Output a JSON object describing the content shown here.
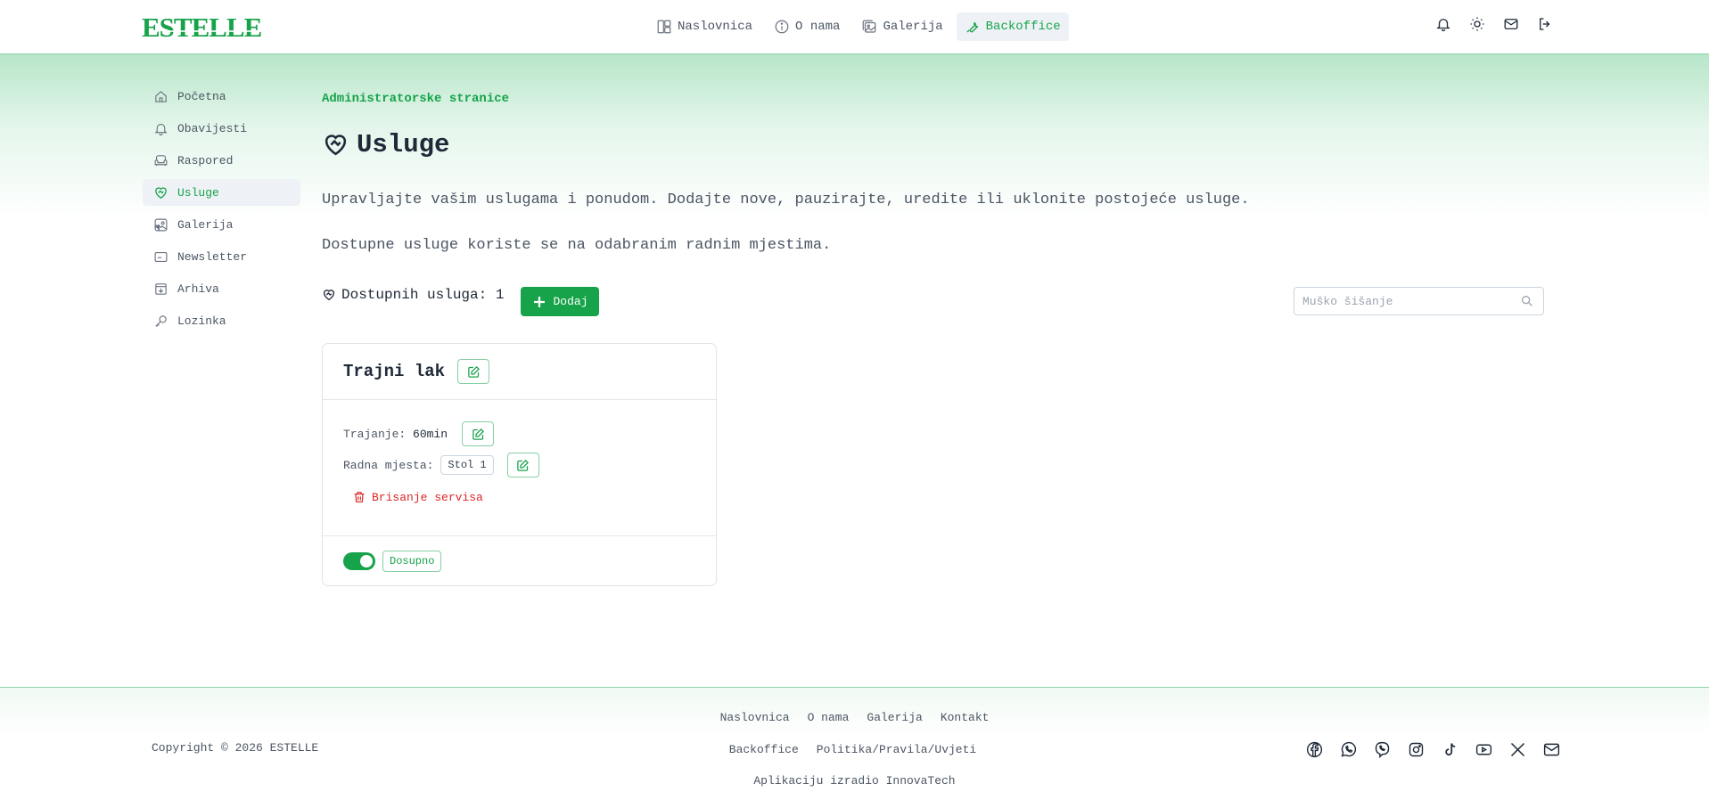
{
  "brand": {
    "logo_text": "ESTELLE",
    "accent": "#16a34a"
  },
  "topnav": [
    {
      "label": "Naslovnica",
      "icon": "layout-icon"
    },
    {
      "label": "O nama",
      "icon": "info-icon"
    },
    {
      "label": "Galerija",
      "icon": "gallery-icon"
    },
    {
      "label": "Backoffice",
      "icon": "wrench-icon",
      "active": true
    }
  ],
  "top_actions": [
    "bell-icon",
    "sun-icon",
    "mail-icon",
    "logout-icon"
  ],
  "sidebar": {
    "items": [
      {
        "label": "Početna",
        "icon": "home-icon"
      },
      {
        "label": "Obavijesti",
        "icon": "bell-icon"
      },
      {
        "label": "Raspored",
        "icon": "armchair-icon"
      },
      {
        "label": "Usluge",
        "icon": "heart-handshake-icon",
        "active": true
      },
      {
        "label": "Galerija",
        "icon": "gallery-icon"
      },
      {
        "label": "Newsletter",
        "icon": "newsletter-icon"
      },
      {
        "label": "Arhiva",
        "icon": "archive-icon"
      },
      {
        "label": "Lozinka",
        "icon": "key-icon"
      }
    ]
  },
  "main": {
    "breadcrumb": "Administratorske stranice",
    "title": "Usluge",
    "description": "Upravljajte vašim uslugama i ponudom. Dodajte nove, pauzirajte, uredite ili uklonite postojeće usluge.",
    "description2": "Dostupne usluge koriste se na odabranim radnim mjestima.",
    "count_label": "Dostupnih usluga: 1",
    "add_label": "Dodaj",
    "search_placeholder": "Muško šišanje"
  },
  "service_card": {
    "name": "Trajni lak",
    "duration_label": "Trajanje:",
    "duration_value": "60min",
    "workplaces_label": "Radna mjesta:",
    "workplaces": [
      "Stol 1"
    ],
    "delete_label": "Brisanje servisa",
    "status_label": "Dosupno",
    "enabled": true
  },
  "footer": {
    "copyright": "Copyright © 2026 ESTELLE",
    "links_row1": [
      "Naslovnica",
      "O nama",
      "Galerija",
      "Kontakt"
    ],
    "links_row2": [
      "Backoffice",
      "Politika/Pravila/Uvjeti"
    ],
    "credit": "Aplikaciju izradio InnovaTech",
    "social": [
      "facebook-icon",
      "whatsapp-icon",
      "viber-icon",
      "instagram-icon",
      "tiktok-icon",
      "youtube-icon",
      "x-icon",
      "mail-icon"
    ]
  }
}
